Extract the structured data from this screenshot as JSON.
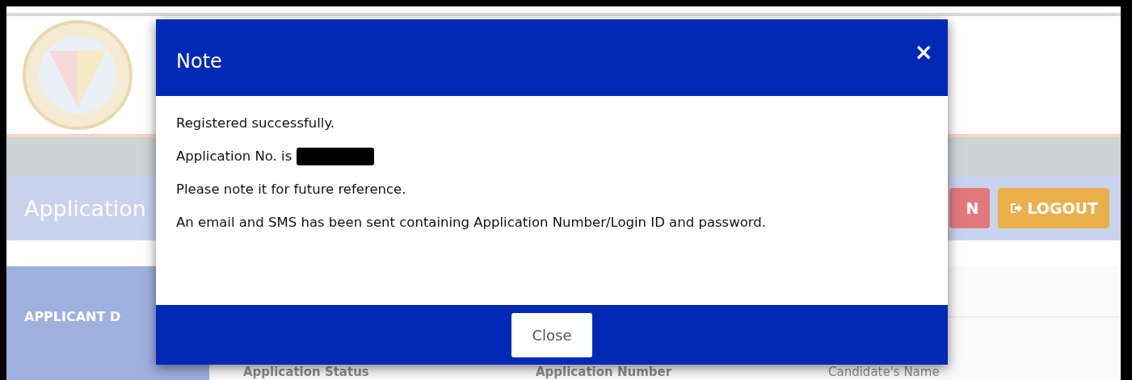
{
  "page": {
    "header_title": "Application",
    "buttons": [
      {
        "label": "N",
        "kind": "danger"
      },
      {
        "label": "LOGOUT",
        "kind": "warning"
      }
    ],
    "sidebar": {
      "items": [
        {
          "label": "APPLICANT D"
        }
      ]
    },
    "columns": [
      "Application Status",
      "Application Number",
      "Candidate's Name"
    ]
  },
  "modal": {
    "title": "Note",
    "close_icon": "×",
    "lines": [
      {
        "text": "Registered successfully.",
        "redacted": false
      },
      {
        "text": "Application No. is",
        "redacted": true
      },
      {
        "text": "Please note it for future reference.",
        "redacted": false
      },
      {
        "text": "An email and SMS has been sent containing Application Number/Login ID and password.",
        "redacted": false
      }
    ],
    "footer_button": "Close"
  }
}
